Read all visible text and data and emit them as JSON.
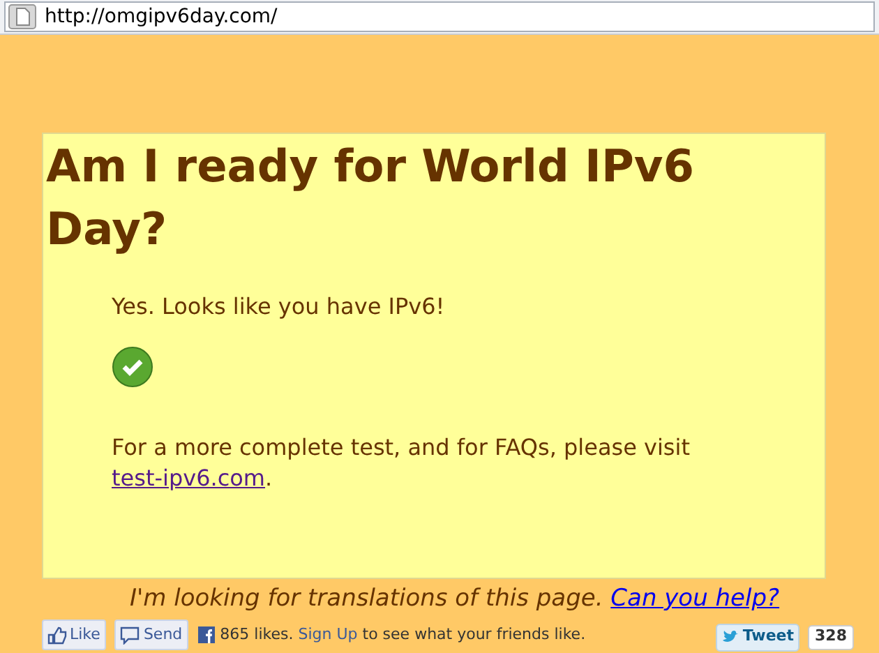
{
  "address_bar": {
    "url": "http://omgipv6day.com/"
  },
  "card": {
    "title": "Am I ready for World IPv6 Day?",
    "result": "Yes. Looks like you have IPv6!",
    "passed": true,
    "note": "For a more complete test, and for FAQs, please visit",
    "link": "test-ipv6.com",
    "after_link": "."
  },
  "translation": {
    "text": "I'm looking for translations of this page.",
    "link": "Can you help?"
  },
  "social": {
    "like": "Like",
    "send": "Send",
    "likes": "865 likes.",
    "sign_up": "Sign Up",
    "rest": "to see what your friends like.",
    "tweet": "Tweet",
    "tweet_count": "328"
  }
}
